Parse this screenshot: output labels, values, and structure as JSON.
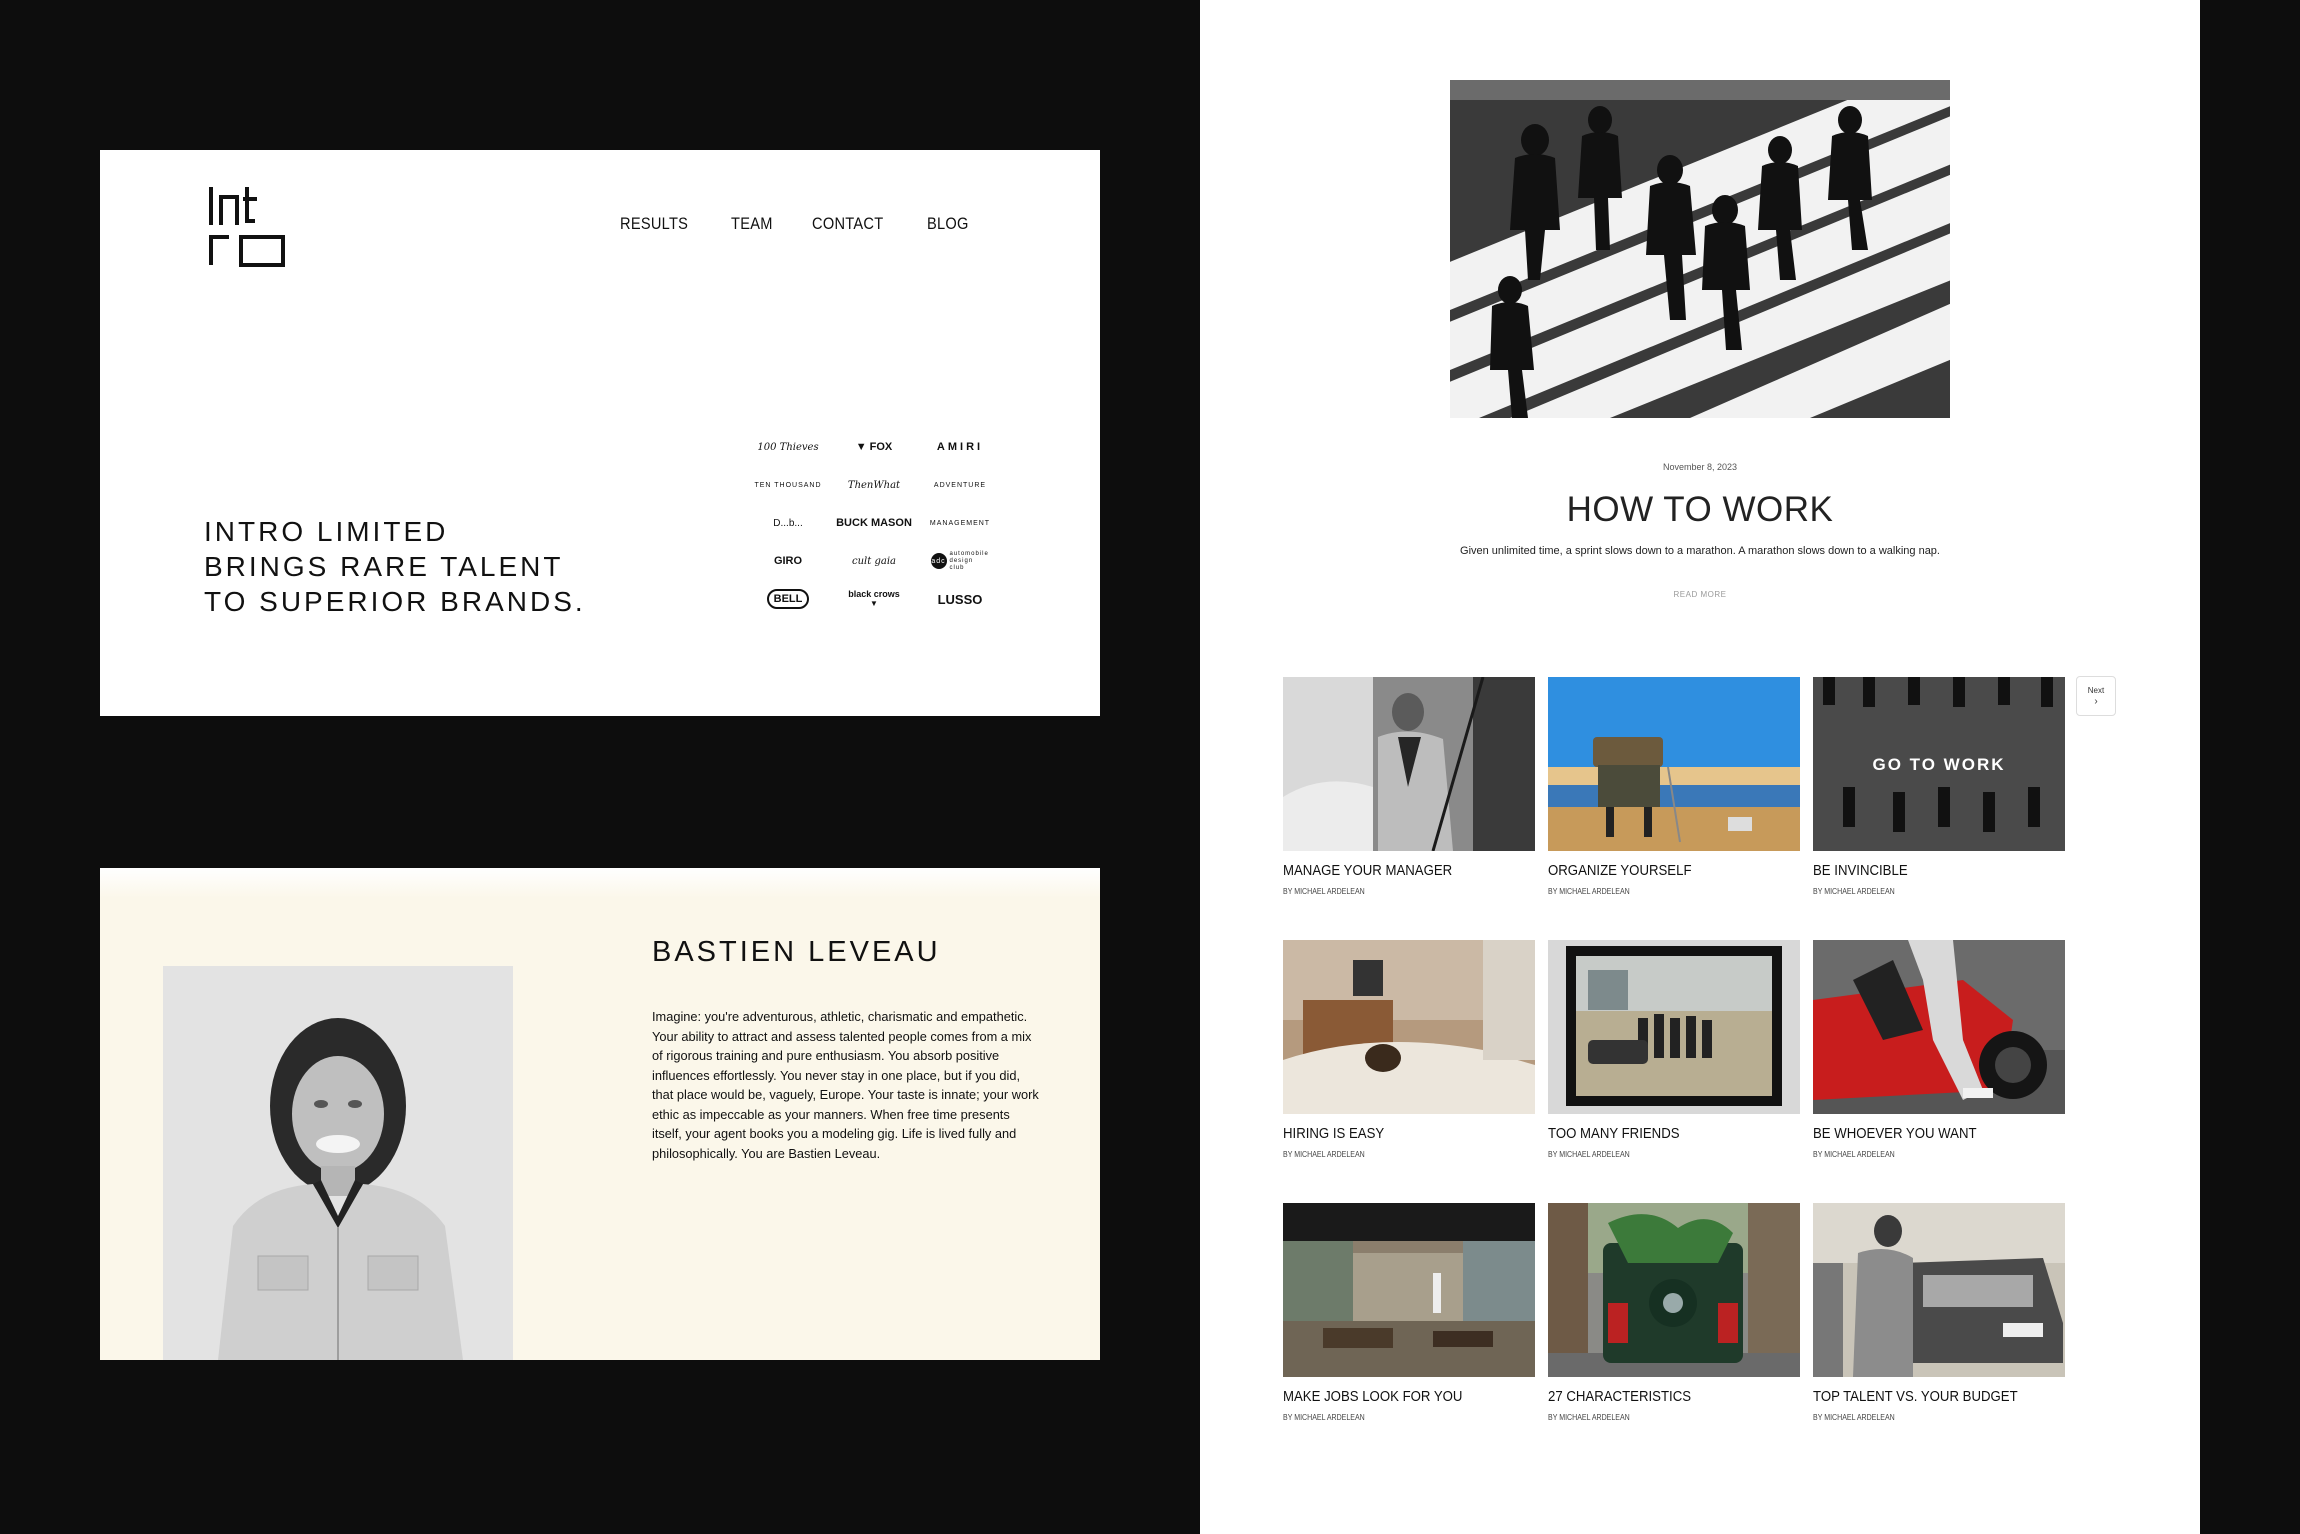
{
  "home": {
    "logo_text": "intro",
    "nav": [
      "RESULTS",
      "TEAM",
      "CONTACT",
      "BLOG"
    ],
    "tagline": [
      "INTRO LIMITED",
      "BRINGS RARE TALENT",
      "TO SUPERIOR BRANDS."
    ],
    "brands": [
      "100 Thieves",
      "FOX",
      "AMIRI",
      "TEN THOUSAND",
      "ThenWhat",
      "ADVENTURE",
      "D...b...",
      "BUCK MASON",
      "MANAGEMENT",
      "GIRO",
      "cult gaia",
      "automobile design club",
      "BELL",
      "black crows",
      "LUSSO"
    ]
  },
  "team": {
    "name": "BASTIEN LEVEAU",
    "bio": "Imagine: you're adventurous, athletic, charismatic and empathetic. Your ability to attract and assess talented people comes from a mix of rigorous training and pure enthusiasm. You absorb positive influences effortlessly. You never stay in one place, but if you did, that place would be, vaguely, Europe. Your taste is innate; your work ethic as impeccable as your manners. When free time presents itself, your agent books you a modeling gig. Life is lived fully and philosophically. You are Bastien Leveau."
  },
  "blog": {
    "featured": {
      "date": "November 8, 2023",
      "title": "HOW TO WORK",
      "excerpt": "Given unlimited time, a sprint slows down to a marathon. A marathon slows down to a walking nap.",
      "read_more": "READ MORE"
    },
    "next_label": "Next",
    "posts": [
      {
        "title": "MANAGE YOUR MANAGER",
        "author": "BY MICHAEL ARDELEAN"
      },
      {
        "title": "ORGANIZE YOURSELF",
        "author": "BY MICHAEL ARDELEAN"
      },
      {
        "title": "BE INVINCIBLE",
        "author": "BY MICHAEL ARDELEAN",
        "overlay": "GO TO WORK"
      },
      {
        "title": "HIRING IS EASY",
        "author": "BY MICHAEL ARDELEAN"
      },
      {
        "title": "TOO MANY FRIENDS",
        "author": "BY MICHAEL ARDELEAN"
      },
      {
        "title": "BE WHOEVER YOU WANT",
        "author": "BY MICHAEL ARDELEAN"
      },
      {
        "title": "MAKE JOBS LOOK FOR YOU",
        "author": "BY MICHAEL ARDELEAN"
      },
      {
        "title": "27 CHARACTERISTICS",
        "author": "BY MICHAEL ARDELEAN"
      },
      {
        "title": "TOP TALENT VS. YOUR BUDGET",
        "author": "BY MICHAEL ARDELEAN"
      }
    ]
  },
  "colors": {
    "background": "#0d0d0d",
    "card": "#ffffff",
    "team_bg": "#fbf7ea",
    "text": "#111111"
  }
}
